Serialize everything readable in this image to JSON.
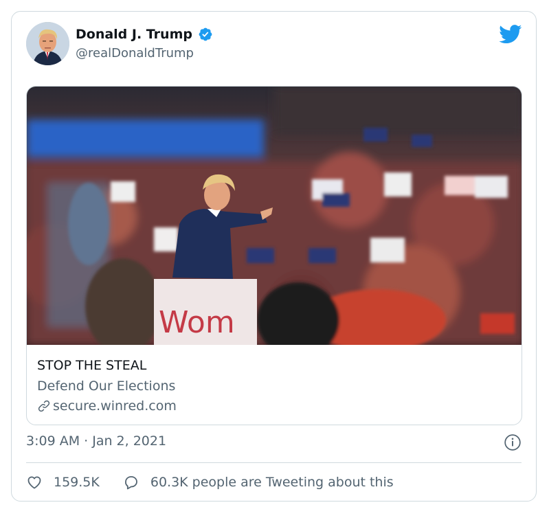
{
  "author": {
    "name": "Donald J. Trump",
    "handle": "@realDonaldTrump",
    "verified": true
  },
  "card": {
    "image_text": "Wom",
    "title": "STOP THE STEAL",
    "description": "Defend Our Elections",
    "domain": "secure.winred.com"
  },
  "meta": {
    "timestamp": "3:09 AM · Jan 2, 2021"
  },
  "actions": {
    "likes": "159.5K",
    "discussion": "60.3K people are Tweeting about this"
  },
  "icons": {
    "verified": "verified-badge-icon",
    "brand": "twitter-bird-icon",
    "link": "link-icon",
    "info": "info-icon",
    "like": "heart-icon",
    "reply": "speech-bubble-icon"
  },
  "colors": {
    "brand": "#1d9bf0",
    "text": "#0f1419",
    "secondary": "#536471",
    "border": "#cfd9de"
  }
}
